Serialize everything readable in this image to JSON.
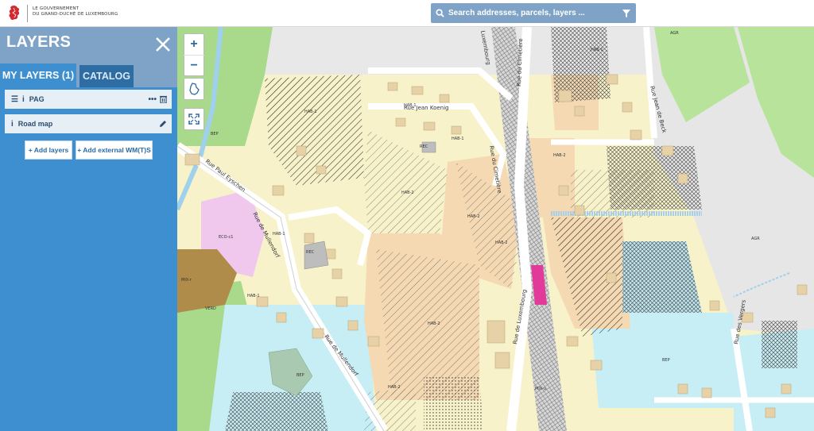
{
  "header": {
    "logo_line1": "LE GOUVERNEMENT",
    "logo_line2": "DU GRAND-DUCHÉ DE LUXEMBOURG",
    "search_placeholder": "Search addresses, parcels, layers ..."
  },
  "panel": {
    "title": "LAYERS",
    "tabs": [
      {
        "label": "MY LAYERS (1)",
        "active": true
      },
      {
        "label": "CATALOG",
        "active": false
      }
    ],
    "layers": [
      {
        "label": "PAG"
      },
      {
        "label": "Road map"
      }
    ],
    "add_layers_label": "+ Add layers",
    "add_external_label": "+ Add external WM(T)S"
  },
  "map_controls": {
    "zoom_in": "+",
    "zoom_out": "−"
  },
  "map": {
    "streets": [
      "Rue Jean Koenig",
      "Rue Paul Eyschen",
      "Rue de Mullendorf",
      "Rue de Mullendorf",
      "Rue de Luxembourg",
      "Rue du Cimetière",
      "Rue du Cimetière",
      "Rue Jean de Beck",
      "Rue des Vergers",
      "Luxembourg"
    ],
    "zones": [
      "HAB-1",
      "HAB-1",
      "HAB-1",
      "HAB-1",
      "HAB-1",
      "HAB-1",
      "HAB-2",
      "HAB-2",
      "HAB-2",
      "HAB-2",
      "HAB-2",
      "HAB-2",
      "REC",
      "REC",
      "ECO-c1",
      "MIX-r",
      "MIX-u",
      "VERD",
      "BEP",
      "BEP",
      "BEP",
      "AGR",
      "AGR"
    ],
    "colors": {
      "hab1": "#f7f2c9",
      "hab2": "#f4d9b3",
      "bep": "#c7eef5",
      "eco": "#f0c8ee",
      "mix_r": "#b08c4a",
      "green": "#a9d98a",
      "agr": "#e6e6e6",
      "water": "#9fd0ec",
      "building": "#e7d2a8",
      "panel": "#3d8fd0",
      "panel_head": "#7fa3c7"
    }
  }
}
